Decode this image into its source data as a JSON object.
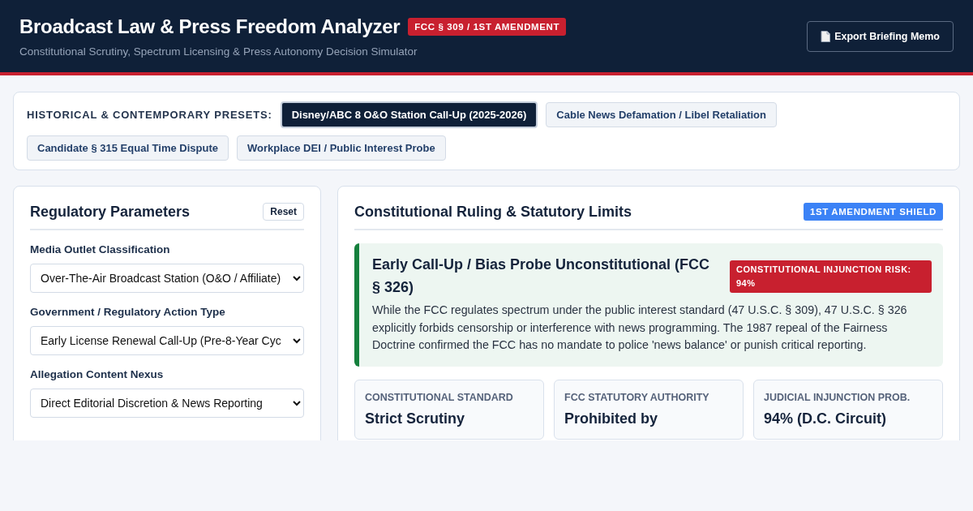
{
  "header": {
    "title": "Broadcast Law & Press Freedom Analyzer",
    "badge": "FCC § 309 / 1ST AMENDMENT",
    "subtitle": "Constitutional Scrutiny, Spectrum Licensing & Press Autonomy Decision Simulator",
    "export_button": "Export Briefing Memo"
  },
  "presets": {
    "label": "HISTORICAL & CONTEMPORARY PRESETS:",
    "items": [
      {
        "label": "Disney/ABC 8 O&O Station Call-Up (2025-2026)",
        "selected": true
      },
      {
        "label": "Cable News Defamation / Libel Retaliation",
        "selected": false
      },
      {
        "label": "Candidate § 315 Equal Time Dispute",
        "selected": false
      },
      {
        "label": "Workplace DEI / Public Interest Probe",
        "selected": false
      }
    ]
  },
  "parameters": {
    "title": "Regulatory Parameters",
    "reset_button": "Reset",
    "fields": [
      {
        "label": "Media Outlet Classification",
        "value": "Over-The-Air Broadcast Station (O&O / Affiliate)"
      },
      {
        "label": "Government / Regulatory Action Type",
        "value": "Early License Renewal Call-Up (Pre-8-Year Cyc"
      },
      {
        "label": "Allegation Content Nexus",
        "value": "Direct Editorial Discretion & News Reporting"
      }
    ]
  },
  "ruling": {
    "title": "Constitutional Ruling & Statutory Limits",
    "badge": "1ST AMENDMENT SHIELD",
    "verdict": {
      "title": "Early Call-Up / Bias Probe Unconstitutional (FCC § 326)",
      "risk_badge": "CONSTITUTIONAL INJUNCTION RISK: 94%",
      "text": "While the FCC regulates spectrum under the public interest standard (47 U.S.C. § 309), 47 U.S.C. § 326 explicitly forbids censorship or interference with news programming. The 1987 repeal of the Fairness Doctrine confirmed the FCC has no mandate to police 'news balance' or punish critical reporting."
    },
    "cards": [
      {
        "label": "CONSTITUTIONAL STANDARD",
        "value": "Strict Scrutiny"
      },
      {
        "label": "FCC STATUTORY AUTHORITY",
        "value": "Prohibited by"
      },
      {
        "label": "JUDICIAL INJUNCTION PROB.",
        "value": "94% (D.C. Circuit)"
      }
    ]
  }
}
